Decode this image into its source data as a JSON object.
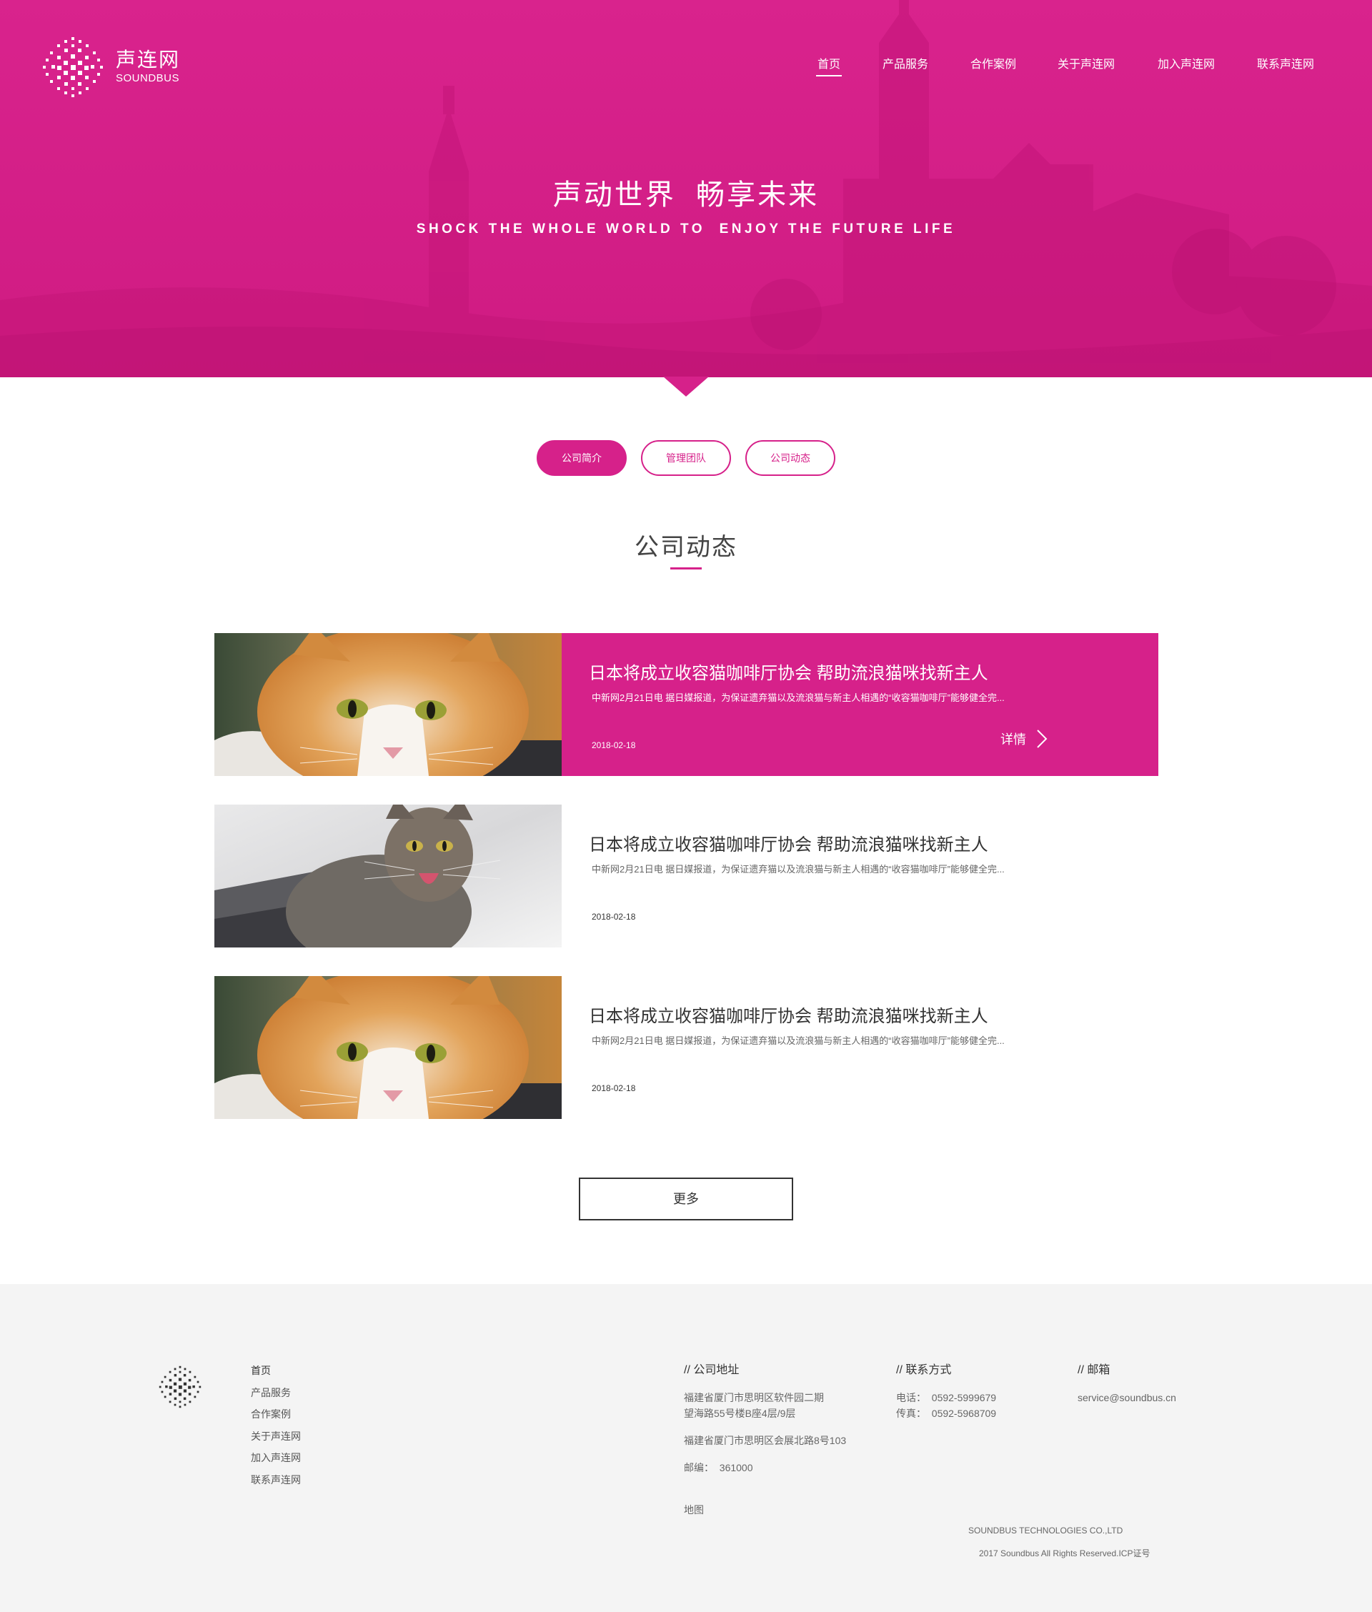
{
  "brand": {
    "name_cn": "声连网",
    "name_en": "SOUNDBUS",
    "accent_color": "#d6218a"
  },
  "nav": {
    "items": [
      {
        "label": "首页",
        "active": true
      },
      {
        "label": "产品服务"
      },
      {
        "label": "合作案例"
      },
      {
        "label": "关于声连网"
      },
      {
        "label": "加入声连网"
      },
      {
        "label": "联系声连网"
      }
    ]
  },
  "hero": {
    "title": "声动世界  畅享未来",
    "subtitle": "SHOCK THE WHOLE WORLD TO  ENJOY THE FUTURE LIFE"
  },
  "tabs": [
    {
      "label": "公司简介",
      "active": true
    },
    {
      "label": "管理团队"
    },
    {
      "label": "公司动态"
    }
  ],
  "section": {
    "title": "公司动态"
  },
  "news": [
    {
      "title": "日本将成立收容猫咖啡厅协会 帮助流浪猫咪找新主人",
      "desc": "中新网2月21日电 据日媒报道，为保证遗弃猫以及流浪猫与新主人相遇的“收容猫咖啡厅”能够健全完...",
      "date": "2018-02-18",
      "more_label": "详情",
      "image": "orange-white-cat-photo"
    },
    {
      "title": "日本将成立收容猫咖啡厅协会 帮助流浪猫咪找新主人",
      "desc": "中新网2月21日电 据日媒报道，为保证遗弃猫以及流浪猫与新主人相遇的“收容猫咖啡厅”能够健全完...",
      "date": "2018-02-18",
      "image": "tabby-cat-photo"
    },
    {
      "title": "日本将成立收容猫咖啡厅协会 帮助流浪猫咪找新主人",
      "desc": "中新网2月21日电 据日媒报道，为保证遗弃猫以及流浪猫与新主人相遇的“收容猫咖啡厅”能够健全完...",
      "date": "2018-02-18",
      "image": "orange-white-cat-photo"
    }
  ],
  "more_button": "更多",
  "footer": {
    "nav": [
      "首页",
      "产品服务",
      "合作案例",
      "关于声连网",
      "加入声连网",
      "联系声连网"
    ],
    "address": {
      "heading": "// 公司地址",
      "line1": "福建省厦门市思明区软件园二期",
      "line2": "望海路55号楼B座4层/9层",
      "line3": "福建省厦门市思明区会展北路8号103",
      "postcode": "邮编：  361000",
      "map": "地图"
    },
    "contact": {
      "heading": "// 联系方式",
      "phone": "电话：  0592-5999679",
      "fax": "传真：  0592-5968709"
    },
    "email": {
      "heading": "// 邮箱",
      "value": "service@soundbus.cn"
    },
    "company": "SOUNDBUS TECHNOLOGIES CO.,LTD",
    "rights": "2017 Soundbus All Rights Reserved.ICP证号"
  }
}
